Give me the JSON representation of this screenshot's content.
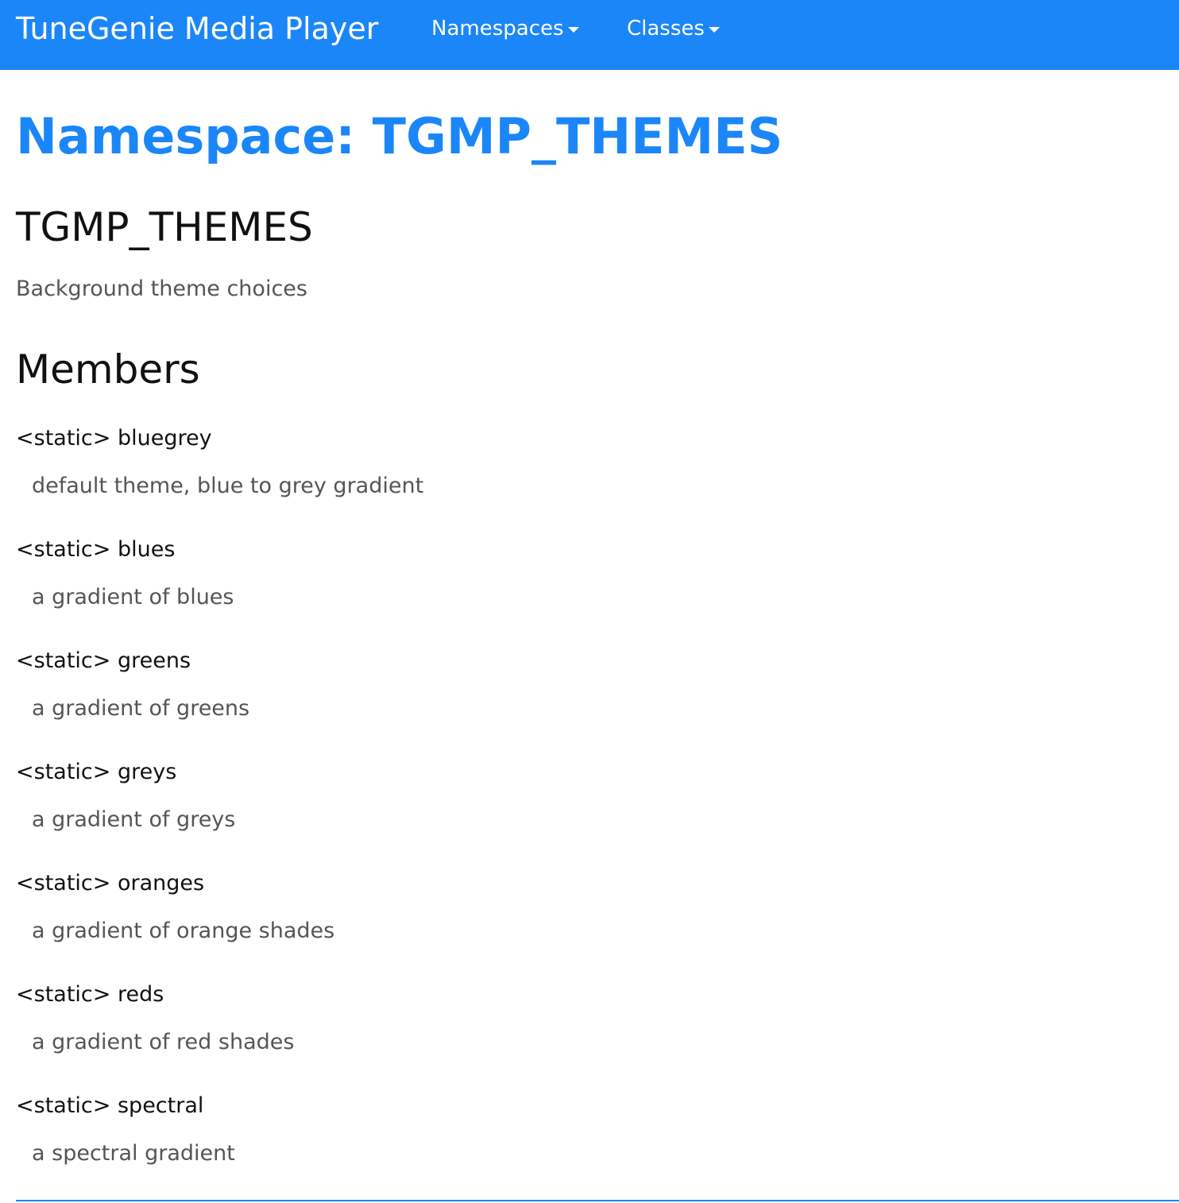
{
  "navbar": {
    "brand": "TuneGenie Media Player",
    "menus": [
      {
        "label": "Namespaces"
      },
      {
        "label": "Classes"
      }
    ]
  },
  "page": {
    "title": "Namespace: TGMP_THEMES",
    "namespace_name": "TGMP_THEMES",
    "description": "Background theme choices",
    "members_heading": "Members"
  },
  "members": [
    {
      "modifier": "<static>",
      "name": "bluegrey",
      "description": "default theme, blue to grey gradient"
    },
    {
      "modifier": "<static>",
      "name": "blues",
      "description": "a gradient of blues"
    },
    {
      "modifier": "<static>",
      "name": "greens",
      "description": "a gradient of greens"
    },
    {
      "modifier": "<static>",
      "name": "greys",
      "description": "a gradient of greys"
    },
    {
      "modifier": "<static>",
      "name": "oranges",
      "description": "a gradient of orange shades"
    },
    {
      "modifier": "<static>",
      "name": "reds",
      "description": "a gradient of red shades"
    },
    {
      "modifier": "<static>",
      "name": "spectral",
      "description": "a spectral gradient"
    }
  ],
  "colors": {
    "accent": "#1b86f8",
    "text": "#111111",
    "muted": "#555555"
  },
  "icons": {
    "dropdown": "caret-down-icon"
  }
}
